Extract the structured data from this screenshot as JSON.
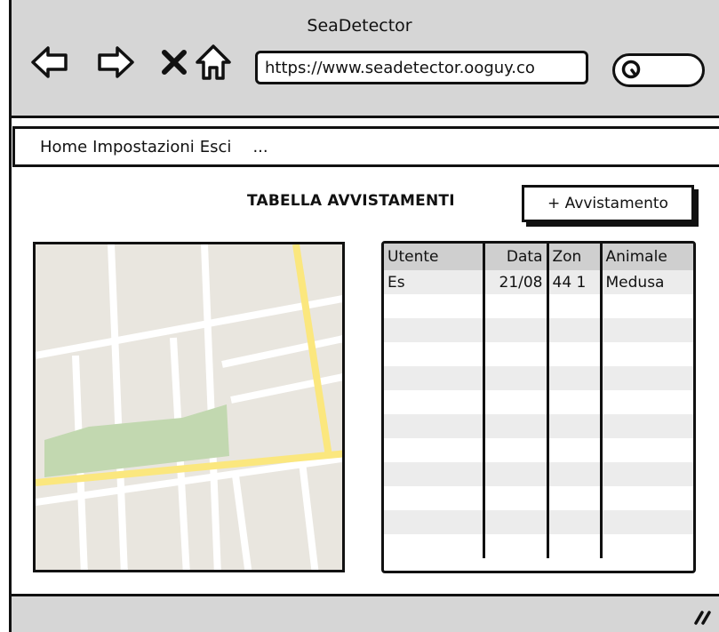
{
  "window": {
    "title": "SeaDetector"
  },
  "toolbar": {
    "back_icon": "arrow-left-icon",
    "forward_icon": "arrow-right-icon",
    "stop_icon": "close-icon",
    "home_icon": "home-icon",
    "url": "https://www.seadetector.ooguy.co",
    "search_icon": "search-icon",
    "search_value": ""
  },
  "menu": {
    "items": [
      "Home",
      "Impostazioni",
      "Esci",
      "..."
    ]
  },
  "main": {
    "title": "TABELLA AVVISTAMENTI",
    "add_button_label": "+ Avvistamento"
  },
  "table": {
    "headers": [
      "Utente",
      "Data",
      "Zon",
      "Animale"
    ],
    "rows": [
      [
        "Es",
        "21/08",
        "44 1",
        "Medusa"
      ],
      [
        "",
        "",
        "",
        ""
      ],
      [
        "",
        "",
        "",
        ""
      ],
      [
        "",
        "",
        "",
        ""
      ],
      [
        "",
        "",
        "",
        ""
      ],
      [
        "",
        "",
        "",
        ""
      ],
      [
        "",
        "",
        "",
        ""
      ],
      [
        "",
        "",
        "",
        ""
      ],
      [
        "",
        "",
        "",
        ""
      ],
      [
        "",
        "",
        "",
        ""
      ],
      [
        "",
        "",
        "",
        ""
      ],
      [
        "",
        "",
        "",
        ""
      ]
    ]
  },
  "colors": {
    "chrome": "#d6d6d6",
    "map_bg": "#e9e6df",
    "map_road_major": "#fbe77e",
    "map_park": "#c2d8b0",
    "header_bg": "#cfcfcf",
    "row_shade": "#ececec"
  },
  "statusbar": {
    "resize_icon": "resize-grip-icon"
  }
}
